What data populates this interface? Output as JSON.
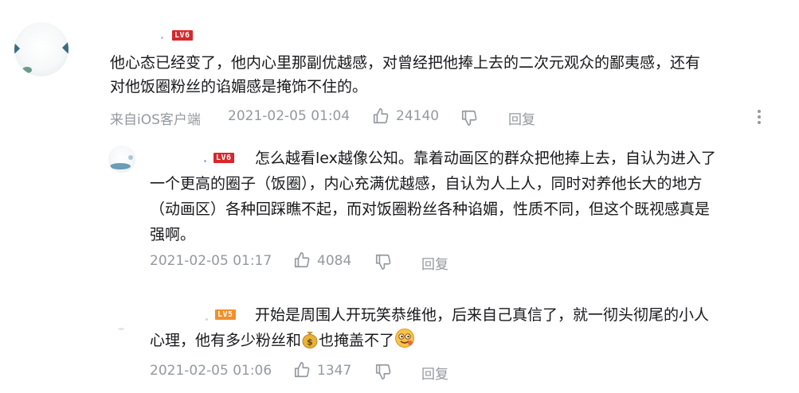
{
  "colors": {
    "text": "#18191c",
    "meta": "#9499a0",
    "level6": "#d9262c",
    "level5": "#f28f2a"
  },
  "main_comment": {
    "level": "LV6",
    "text_line1": "他心态已经变了，他内心里那副优越感，对曾经把他捧上去的二次元观众的鄙夷感，还有",
    "text_line2": "对他饭圈粉丝的谄媚感是掩饰不住的。",
    "source": "来自iOS客户端",
    "timestamp": "2021-02-05 01:04",
    "likes": "24140",
    "reply_label": "回复",
    "icons": [
      "thumb-up-icon",
      "thumb-down-icon",
      "more-vertical-icon"
    ]
  },
  "replies": [
    {
      "level": "LV6",
      "line1": "怎么越看lex越像公知。靠着动画区的群众把他捧上去，自认为进入了",
      "line2": "一个更高的圈子（饭圈），内心充满优越感，自认为人上人，同时对养他长大的地方",
      "line3": "（动画区）各种回踩瞧不起，而对饭圈粉丝各种谄媚，性质不同，但这个既视感真是",
      "line4": "强啊。",
      "timestamp": "2021-02-05 01:17",
      "likes": "4084",
      "reply_label": "回复"
    },
    {
      "level": "LV5",
      "line1": "开始是周围人开玩笑恭维他，后来自己真信了，就一彻头彻尾的小人",
      "line2_a": "心理，他有多少粉丝和",
      "line2_b": "也掩盖不了",
      "timestamp": "2021-02-05 01:06",
      "likes": "1347",
      "reply_label": "回复",
      "emojis": [
        "money-bag-icon",
        "sly-smile-emoji-icon"
      ]
    }
  ]
}
